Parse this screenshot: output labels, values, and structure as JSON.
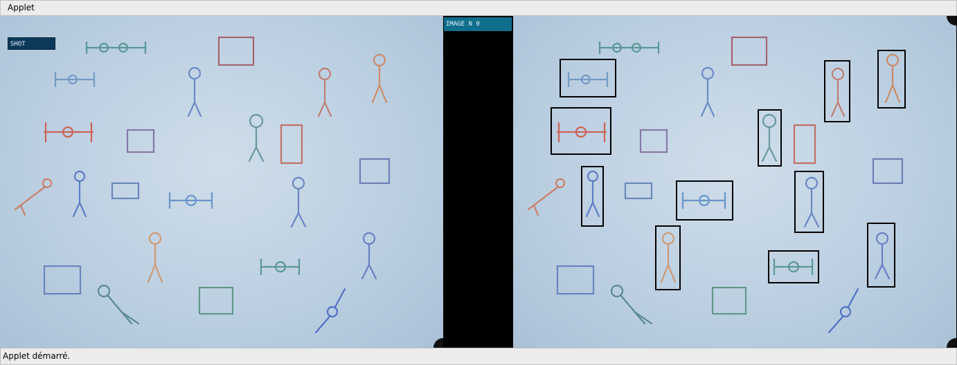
{
  "window": {
    "title": "Applet"
  },
  "toolbar": {
    "shot_label": "SHOT"
  },
  "viewer": {
    "image_label": "IMAGE N 0"
  },
  "status": {
    "text": "Applet démarré."
  }
}
